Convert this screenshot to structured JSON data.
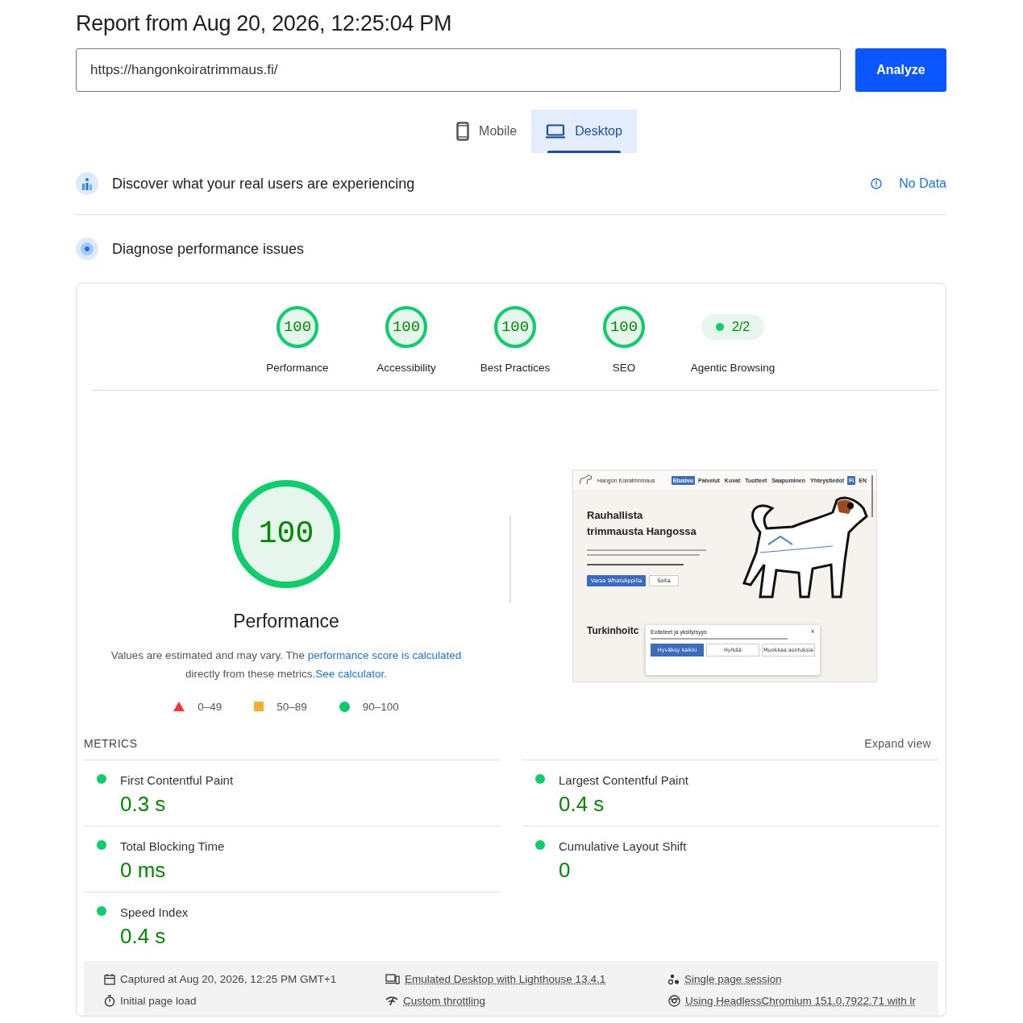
{
  "report_title": "Report from Aug 20, 2026, 12:25:04 PM",
  "url_field": {
    "value": "https://hangonkoiratrimmaus.fi/"
  },
  "analyze_button": "Analyze",
  "device_tabs": [
    {
      "label": "Mobile",
      "kind": "phone",
      "selected": false
    },
    {
      "label": "Desktop",
      "kind": "laptop",
      "selected": true
    }
  ],
  "field_data": {
    "heading": "Discover what your real users are experiencing",
    "status": "No Data"
  },
  "lab_data": {
    "heading": "Diagnose performance issues"
  },
  "scores": [
    {
      "kind": "gauge",
      "score": "100",
      "level": 1,
      "label": "Performance"
    },
    {
      "kind": "gauge",
      "score": "100",
      "level": 1,
      "label": "Accessibility"
    },
    {
      "kind": "gauge",
      "score": "100",
      "level": 1,
      "label": "Best Practices"
    },
    {
      "kind": "gauge",
      "score": "100",
      "level": 1,
      "label": "SEO"
    },
    {
      "kind": "pill",
      "score": "2/2",
      "label": "Agentic Browsing"
    }
  ],
  "main_score": {
    "score": "100",
    "level": 1,
    "label": "Performance"
  },
  "description": {
    "text_before": "Values are estimated and may vary. The",
    "link_1": "performance score is calculated",
    "text_after": "directly from these metrics.",
    "link_2": "See calculator."
  },
  "legend": [
    {
      "kind": "triangle",
      "range": "0–49"
    },
    {
      "kind": "square",
      "range": "50–89"
    },
    {
      "kind": "circle",
      "range": "90–100"
    }
  ],
  "screenshot": {
    "site_name": "Hangon Koiratrimmaus",
    "nav": [
      {
        "label": "Etusivu",
        "selected": true
      },
      {
        "label": "Palvelut",
        "selected": false
      },
      {
        "label": "Kuvat",
        "selected": false
      },
      {
        "label": "Tuotteet",
        "selected": false
      },
      {
        "label": "Saapuminen",
        "selected": false
      },
      {
        "label": "Yhteystiedot",
        "selected": false
      }
    ],
    "languages": [
      {
        "label": "FI",
        "selected": true
      },
      {
        "label": "EN",
        "selected": false
      }
    ],
    "heading_lines": [
      "Rauhallista",
      "trimmausta Hangossa"
    ],
    "buttons": [
      "Varaa WhatsAppilla",
      "Soita"
    ],
    "section_heading": "Turkinhoitc",
    "cookie_dialog": {
      "title": "Evästeet ja yksityisyys",
      "close": "×",
      "buttons": [
        "Hyväksy kaikki",
        "Hylkää",
        "Muokkaa asetuksia"
      ]
    }
  },
  "metrics": {
    "title": "METRICS",
    "toggle": "Expand view",
    "items": [
      {
        "name": "First Contentful Paint",
        "value": "0.3 s"
      },
      {
        "name": "Largest Contentful Paint",
        "value": "0.4 s"
      },
      {
        "name": "Total Blocking Time",
        "value": "0 ms"
      },
      {
        "name": "Cumulative Layout Shift",
        "value": "0"
      },
      {
        "name": "Speed Index",
        "value": "0.4 s"
      }
    ]
  },
  "footer": [
    {
      "kind": "calendar",
      "text": "Captured at Aug 20, 2026, 12:25 PM GMT+1",
      "link": false
    },
    {
      "kind": "devices",
      "text": "Emulated Desktop with Lighthouse 13.4.1",
      "link": true
    },
    {
      "kind": "dots",
      "text": "Single page session",
      "link": true
    },
    {
      "kind": "timer",
      "text": "Initial page load",
      "link": false
    },
    {
      "kind": "signal",
      "text": "Custom throttling",
      "link": true
    },
    {
      "kind": "browser",
      "text": "Using HeadlessChromium 151.0.7922.71 with lr",
      "link": true
    }
  ]
}
